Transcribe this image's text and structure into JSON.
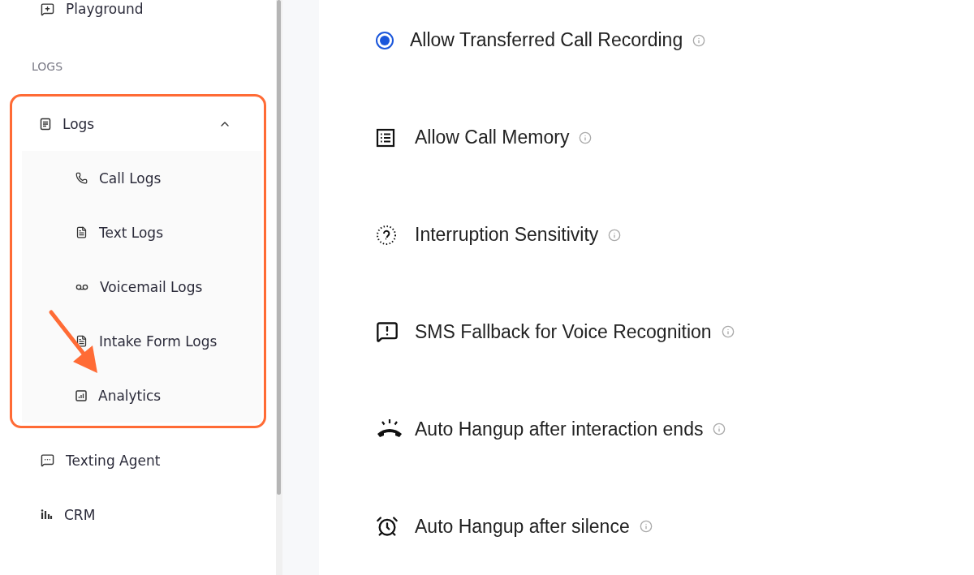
{
  "sidebar": {
    "items": [
      {
        "label": "Playground",
        "kind": "item"
      },
      {
        "label": "LOGS",
        "kind": "header"
      },
      {
        "label": "Logs",
        "kind": "group",
        "expanded": true,
        "children": [
          {
            "label": "Call Logs"
          },
          {
            "label": "Text Logs"
          },
          {
            "label": "Voicemail Logs"
          },
          {
            "label": "Intake Form Logs"
          },
          {
            "label": "Analytics"
          }
        ]
      },
      {
        "label": "Texting Agent",
        "kind": "item"
      },
      {
        "label": "CRM",
        "kind": "item"
      }
    ]
  },
  "settings": [
    {
      "label": "Allow Transferred Call Recording",
      "kind": "radio",
      "checked": true
    },
    {
      "label": "Allow Call Memory",
      "kind": "icon"
    },
    {
      "label": "Interruption Sensitivity",
      "kind": "icon"
    },
    {
      "label": "SMS Fallback for Voice Recognition",
      "kind": "icon"
    },
    {
      "label": "Auto Hangup after interaction ends",
      "kind": "icon"
    },
    {
      "label": "Auto Hangup after silence",
      "kind": "icon"
    }
  ]
}
